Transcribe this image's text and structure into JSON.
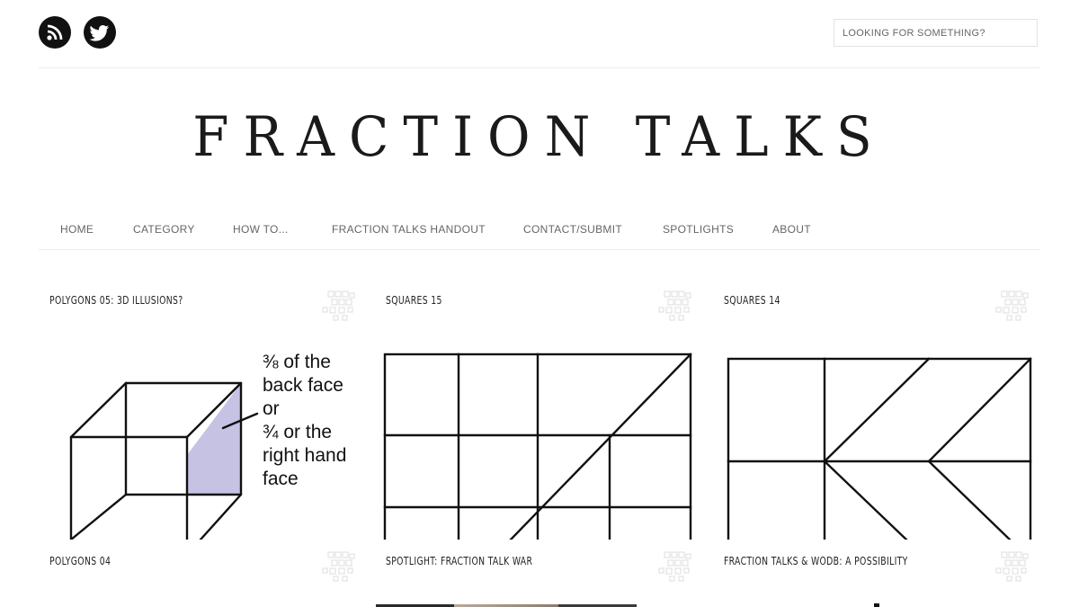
{
  "header": {
    "social": [
      {
        "name": "rss-icon"
      },
      {
        "name": "twitter-icon"
      }
    ],
    "search_placeholder": "LOOKING FOR SOMETHING?"
  },
  "site_title": "FRACTION TALKS",
  "nav": [
    {
      "label": "HOME"
    },
    {
      "label": "CATEGORY"
    },
    {
      "label": "HOW TO..."
    },
    {
      "label": "FRACTION TALKS HANDOUT"
    },
    {
      "label": "CONTACT/SUBMIT"
    },
    {
      "label": "SPOTLIGHTS"
    },
    {
      "label": "ABOUT"
    }
  ],
  "posts": [
    {
      "title": "POLYGONS 05: 3D ILLUSIONS?"
    },
    {
      "title": "SQUARES 15"
    },
    {
      "title": "SQUARES 14"
    },
    {
      "title": "POLYGONS 04"
    },
    {
      "title": "SPOTLIGHT: FRACTION TALK WAR"
    },
    {
      "title": "FRACTION TALKS & WODB: A POSSIBILITY"
    }
  ],
  "cube_annotation": {
    "lines": [
      "⅜ of the",
      "back face",
      "or",
      "¾ or the",
      "right hand",
      "face"
    ],
    "shade_color": "#c5c2e4"
  }
}
